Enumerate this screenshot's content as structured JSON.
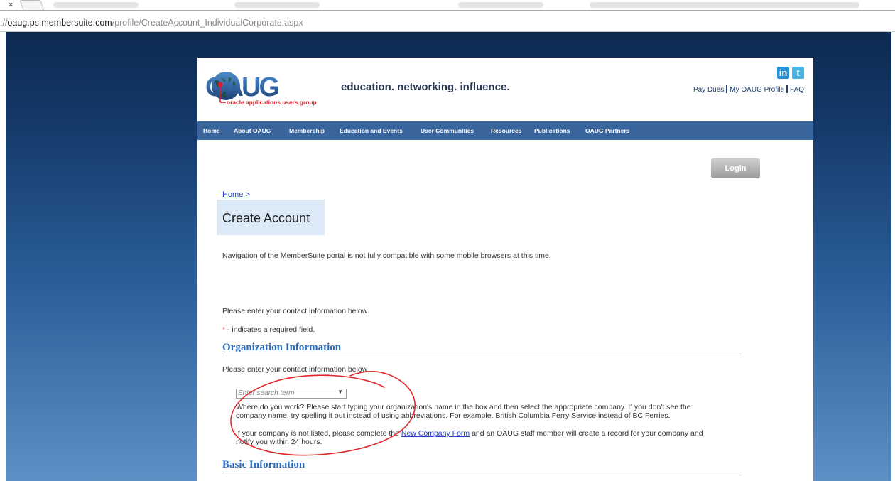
{
  "browser": {
    "tab_close": "×",
    "url_prefix": "://",
    "url_host": "oaug.ps.membersuite.com",
    "url_path": "/profile/CreateAccount_IndividualCorporate.aspx"
  },
  "header": {
    "tagline": "education. networking. influence.",
    "logo_label": "oracle applications users group",
    "logo_text": "OAUG",
    "social_icons": [
      "linkedin-icon",
      "twitter-icon"
    ],
    "links": [
      "Pay Dues",
      "My OAUG Profile",
      "FAQ"
    ]
  },
  "nav": {
    "items": [
      "Home",
      "About OAUG",
      "Membership",
      "Education and Events",
      "User Communities",
      "Resources",
      "Publications",
      "OAUG Partners"
    ]
  },
  "login_label": "Login",
  "breadcrumb": "Home >",
  "page_title": "Create Account",
  "mobile_notice": "Navigation of the MemberSuite portal is not fully compatible with some mobile browsers at this time.",
  "contact_intro": "Please enter your contact information below.",
  "required_star": "*",
  "required_note": " - indicates a required field.",
  "org_section": {
    "heading": "Organization Information",
    "intro": "Please enter your contact information below.",
    "search_placeholder": "Enter search term",
    "help_line1": "Where do you work? Please start typing your organization's name in the box and then select the appropriate company. If you don't see the",
    "help_line2": "company name, try spelling it out instead of using abbreviations. For example, British Columbia Ferry Service instead of BC Ferries.",
    "notlisted_pre": "If your company is not listed, please complete the ",
    "notlisted_link": "New Company Form",
    "notlisted_post": " and an OAUG staff member will create a record for your company and",
    "notlisted_line2": "notify you within 24 hours."
  },
  "basic_section": {
    "heading": "Basic Information"
  },
  "colors": {
    "nav_bg": "#39659c",
    "section_heading": "#2b6bbd",
    "annotation": "#e0262b"
  }
}
